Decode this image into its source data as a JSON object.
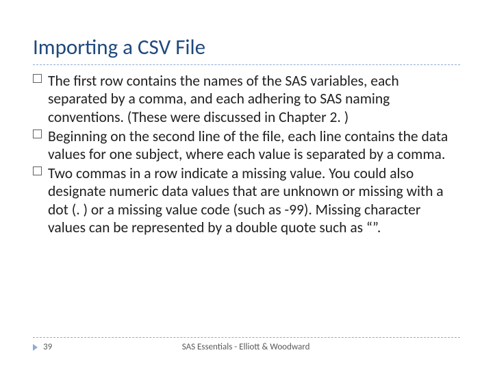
{
  "title": "Importing a CSV File",
  "bullets": [
    "The first row contains the names of the SAS variables, each separated by a comma, and each adhering to SAS naming conventions. (These were discussed in Chapter 2. )",
    "Beginning on the second line of the file, each line contains the data values for one subject, where each value is separated by a comma.",
    "Two commas in a row indicate a missing value. You could also designate numeric data values that are unknown or missing with a dot (. ) or a missing value code (such as -99). Missing character values can be represented by a double quote such as “”."
  ],
  "footer": {
    "page_num": "39",
    "center_text": "SAS Essentials - Elliott & Woodward"
  }
}
